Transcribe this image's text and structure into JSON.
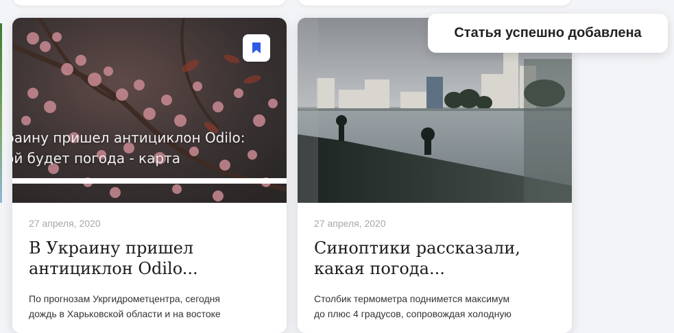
{
  "cards": [
    {
      "date": "27 апреля, 2020",
      "title_line1": "В Украину пришел",
      "title_line2": "антициклон Odilo...",
      "excerpt_line1": "По прогнозам Укргидрометцентра, сегодня",
      "excerpt_line2": "дождь в Харьковской области и на востоке",
      "overlay_line1": "краину пришел антициклон Odilo:",
      "overlay_line2": "кой будет погода - карта",
      "bookmark_icon": "bookmark-icon",
      "accent_color": "#2d5be3"
    },
    {
      "date": "27 апреля, 2020",
      "title_line1": "Синоптики рассказали,",
      "title_line2": "какая погода...",
      "excerpt_line1": "Столбик термометра поднимется максимум",
      "excerpt_line2": "до плюс 4 градусов, сопровождая холодную"
    }
  ],
  "toast": {
    "message": "Статья успешно добавлена"
  }
}
